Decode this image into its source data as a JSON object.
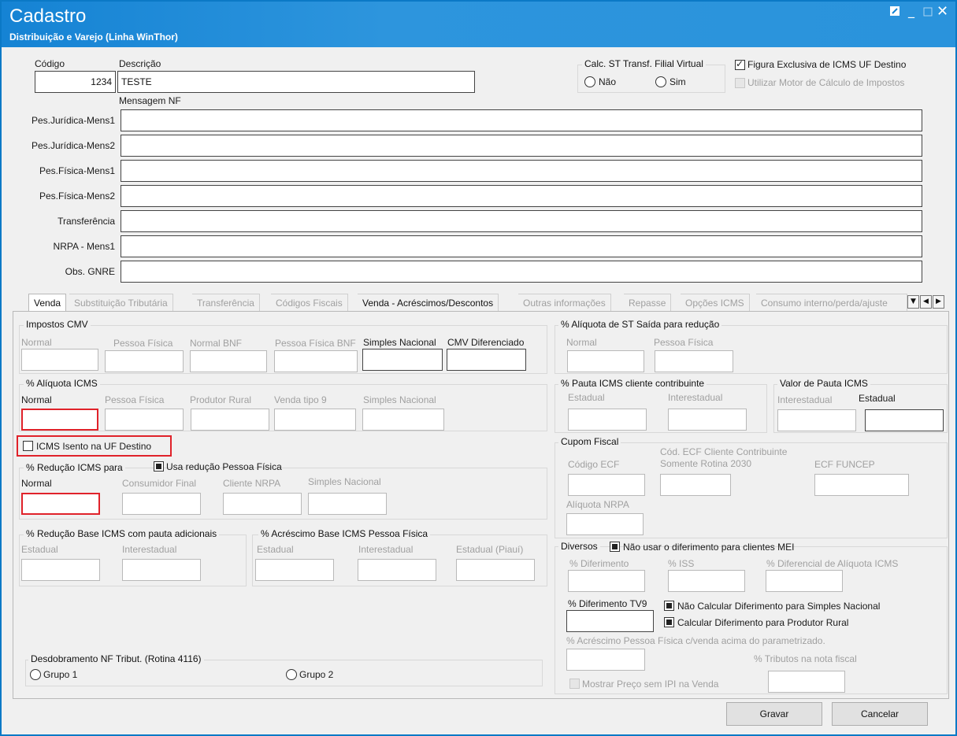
{
  "window": {
    "title": "Cadastro",
    "subtitle": "Distribuição e Varejo (Linha WinThor)",
    "controls": [
      "restore-icon",
      "minimize-icon",
      "maximize-icon",
      "close-icon"
    ]
  },
  "header": {
    "codigo_label": "Código",
    "codigo_value": "1234",
    "descricao_label": "Descrição",
    "descricao_value": "TESTE",
    "mensagem_nf_label": "Mensagem NF",
    "calc_st_group": "Calc. ST Transf. Filial Virtual",
    "radio_nao": "Não",
    "radio_sim": "Sim",
    "figura_exclusiva": "Figura Exclusiva de ICMS UF Destino",
    "utilizar_motor": "Utilizar Motor de Cálculo de Impostos"
  },
  "messages": [
    {
      "label": "Pes.Jurídica-Mens1",
      "value": ""
    },
    {
      "label": "Pes.Jurídica-Mens2",
      "value": ""
    },
    {
      "label": "Pes.Física-Mens1",
      "value": ""
    },
    {
      "label": "Pes.Física-Mens2",
      "value": ""
    },
    {
      "label": "Transferência",
      "value": ""
    },
    {
      "label": "NRPA - Mens1",
      "value": ""
    },
    {
      "label": "Obs. GNRE",
      "value": ""
    }
  ],
  "tabs": [
    {
      "label": "Venda",
      "active": true
    },
    {
      "label": "Substituição Tributária"
    },
    {
      "label": "Transferência"
    },
    {
      "label": "Códigos Fiscais"
    },
    {
      "label": "Venda - Acréscimos/Descontos"
    },
    {
      "label": "Outras informações"
    },
    {
      "label": "Repasse"
    },
    {
      "label": "Opções ICMS"
    },
    {
      "label": "Consumo interno/perda/ajuste"
    }
  ],
  "left": {
    "impostos_cmv": {
      "title": "Impostos CMV",
      "fields": [
        "Normal",
        "Pessoa Física",
        "Normal BNF",
        "Pessoa Física BNF",
        "Simples Nacional",
        "CMV Diferenciado"
      ]
    },
    "aliquota_icms": {
      "title": "% Alíquota ICMS",
      "fields": [
        "Normal",
        "Pessoa Física",
        "Produtor Rural",
        "Venda tipo 9",
        "Simples Nacional"
      ]
    },
    "icms_isento": "ICMS Isento na UF Destino",
    "reducao_icms": {
      "title": "% Redução ICMS para",
      "usa_reducao": "Usa redução Pessoa Física",
      "fields": [
        "Normal",
        "Consumidor Final",
        "Cliente NRPA",
        "Simples Nacional"
      ]
    },
    "reducao_base": {
      "title": "% Redução Base ICMS com pauta adicionais",
      "fields": [
        "Estadual",
        "Interestadual"
      ]
    },
    "acrescimo_base": {
      "title": "% Acréscimo Base ICMS Pessoa Física",
      "fields": [
        "Estadual",
        "Interestadual",
        "Estadual (Piauí)"
      ]
    },
    "desdobramento": {
      "title": "Desdobramento NF Tribut. (Rotina 4116)",
      "grupo1": "Grupo 1",
      "grupo2": "Grupo 2"
    }
  },
  "right": {
    "aliquota_st": {
      "title": "% Alíquota de ST Saída para redução",
      "fields": [
        "Normal",
        "Pessoa Física"
      ]
    },
    "pauta_icms": {
      "title": "% Pauta ICMS cliente contribuinte",
      "fields": [
        "Estadual",
        "Interestadual"
      ]
    },
    "valor_pauta": {
      "title": "Valor de Pauta ICMS",
      "fields": [
        "Interestadual",
        "Estadual"
      ]
    },
    "cupom_fiscal": {
      "title": "Cupom Fiscal",
      "codigo_ecf": "Código ECF",
      "cod_ecf_cliente_1": "Cód. ECF Cliente Contribuinte",
      "cod_ecf_cliente_2": "Somente Rotina 2030",
      "ecf_funcep": "ECF FUNCEP",
      "aliquota_nrpa": "Alíquota NRPA"
    },
    "diversos": {
      "title": "Diversos",
      "nao_usar_diferimento": "Não usar o diferimento para clientes MEI",
      "diferimento": "% Diferimento",
      "iss": "% ISS",
      "diferencial": "% Diferencial de Alíquota ICMS",
      "diferimento_tv9": "% Diferimento TV9",
      "nao_calcular": "Não Calcular Diferimento para Simples Nacional",
      "calcular_produtor": "Calcular Diferimento para Produtor Rural",
      "acrescimo_pf": "% Acréscimo Pessoa Física c/venda acima do parametrizado.",
      "tributos_nota": "% Tributos na nota fiscal",
      "mostrar_preco": "Mostrar Preço sem IPI na Venda"
    }
  },
  "footer": {
    "gravar": "Gravar",
    "cancelar": "Cancelar"
  }
}
